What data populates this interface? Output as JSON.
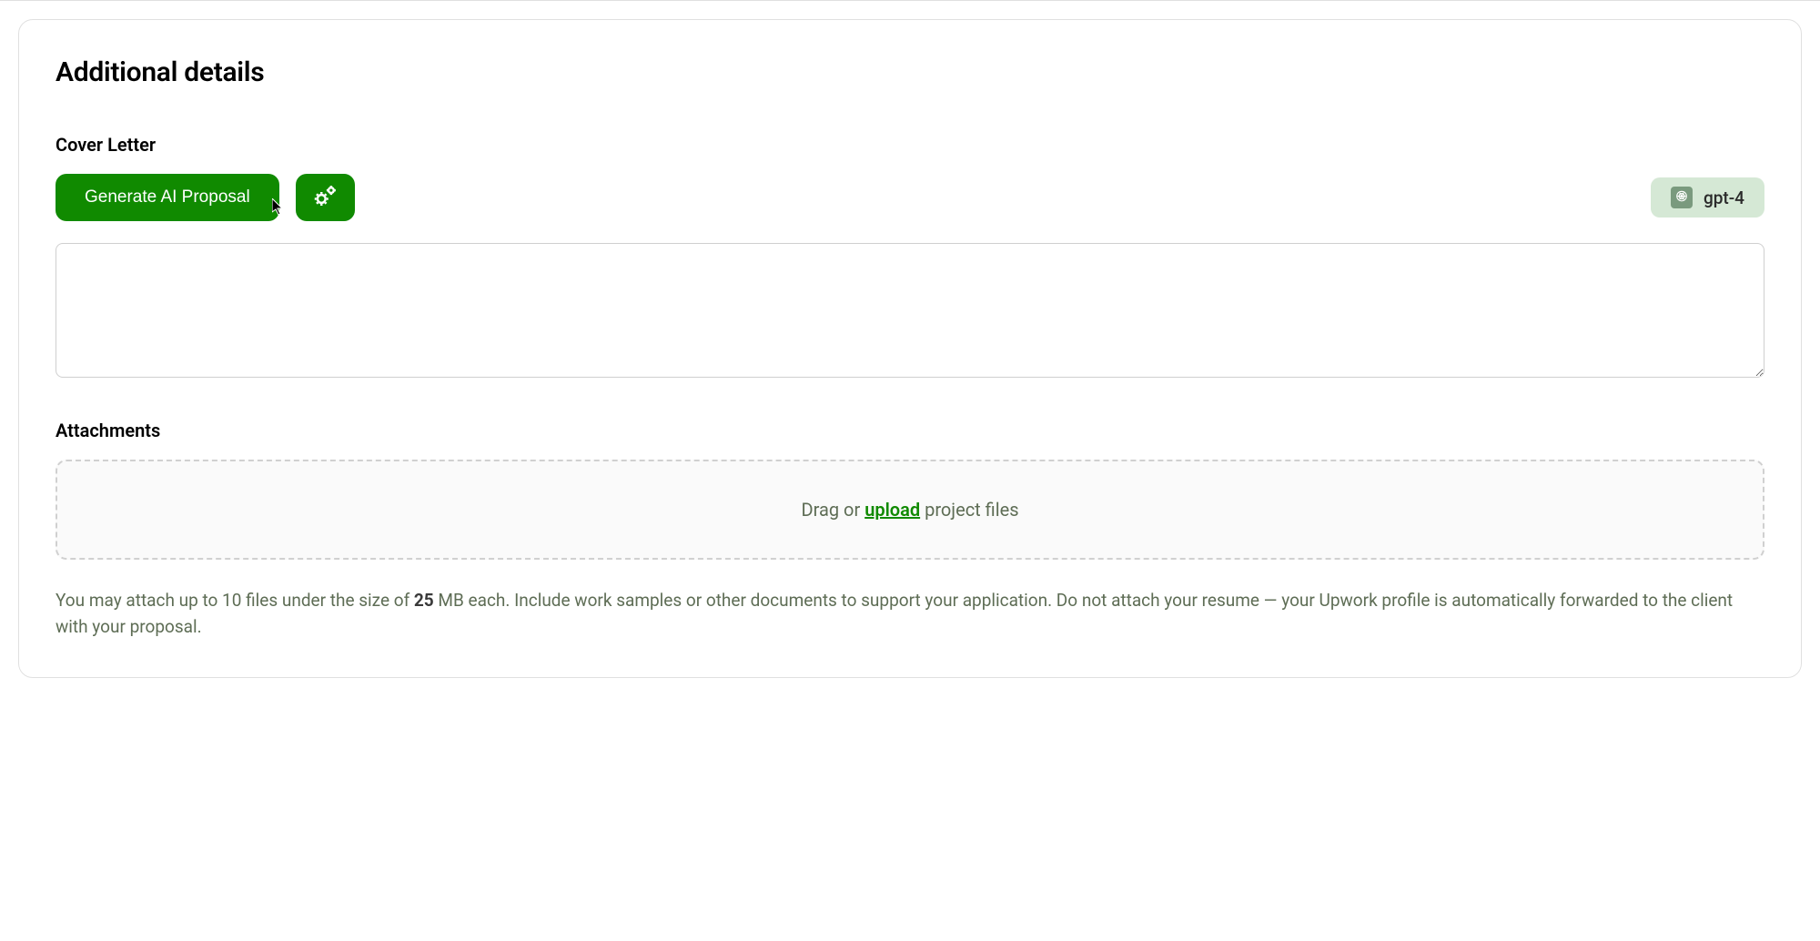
{
  "section": {
    "title": "Additional details"
  },
  "coverLetter": {
    "label": "Cover Letter",
    "generateButton": "Generate AI Proposal",
    "modelBadge": "gpt-4",
    "textValue": ""
  },
  "attachments": {
    "label": "Attachments",
    "dropzonePrefix": "Drag or ",
    "dropzoneLink": "upload",
    "dropzoneSuffix": " project files",
    "helpTextPrefix": "You may attach up to 10 files under the size of ",
    "helpTextBold": "25",
    "helpTextSuffix": " MB each. Include work samples or other documents to support your application. Do not attach your resume — your Upwork profile is automatically forwarded to the client with your proposal."
  }
}
